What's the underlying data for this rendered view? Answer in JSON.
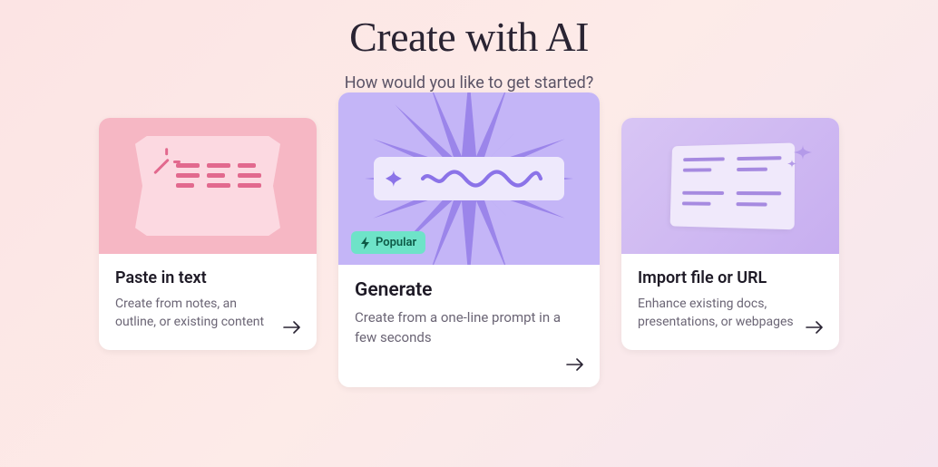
{
  "header": {
    "title": "Create with AI",
    "subtitle": "How would you like to get started?"
  },
  "cards": {
    "paste": {
      "title": "Paste in text",
      "desc": "Create from notes, an outline, or existing content"
    },
    "generate": {
      "title": "Generate",
      "desc": "Create from a one-line prompt in a few seconds",
      "badge": "Popular"
    },
    "import": {
      "title": "Import file or URL",
      "desc": "Enhance existing docs, presentations, or webpages"
    }
  }
}
